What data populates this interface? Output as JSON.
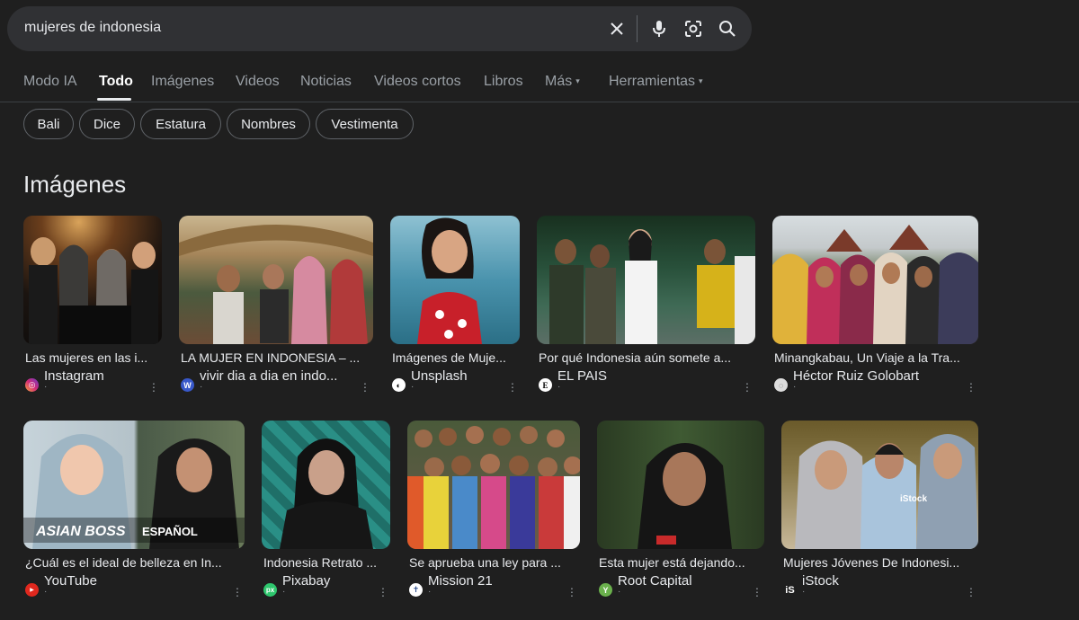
{
  "search": {
    "query": "mujeres de indonesia"
  },
  "tabs": [
    "Modo IA",
    "Todo",
    "Imágenes",
    "Videos",
    "Noticias",
    "Videos cortos",
    "Libros",
    "Más",
    "Herramientas"
  ],
  "chips": [
    "Bali",
    "Dice",
    "Estatura",
    "Nombres",
    "Vestimenta"
  ],
  "section_title": "Imágenes",
  "images": [
    {
      "caption": "Las mujeres en las i...",
      "source": "Instagram"
    },
    {
      "caption": "LA MUJER EN INDONESIA – ...",
      "source": "vivir dia a dia en indo..."
    },
    {
      "caption": "Imágenes de Muje...",
      "source": "Unsplash"
    },
    {
      "caption": "Por qué Indonesia aún somete a...",
      "source": "EL PAIS"
    },
    {
      "caption": "Minangkabau, Un Viaje a la Tra...",
      "source": "Héctor Ruiz Golobart"
    },
    {
      "caption": "¿Cuál es el ideal de belleza en In...",
      "source": "YouTube"
    },
    {
      "caption": "Indonesia Retrato ...",
      "source": "Pixabay"
    },
    {
      "caption": "Se aprueba una ley para ...",
      "source": "Mission 21"
    },
    {
      "caption": "Esta mujer está dejando...",
      "source": "Root Capital"
    },
    {
      "caption": "Mujeres Jóvenes De Indonesi...",
      "source": "iStock"
    }
  ],
  "overlay": {
    "asian_boss": "ASIAN BOSS",
    "espanol": "ESPAÑOL"
  },
  "favicon_glyphs": [
    "◎",
    "W",
    "◐",
    "E",
    "◌",
    "▶",
    "px",
    "✝",
    "Y",
    "iS"
  ],
  "colors": {
    "background": "#1f1f1f",
    "search_bg": "#303134",
    "muted": "#9aa0a6"
  }
}
